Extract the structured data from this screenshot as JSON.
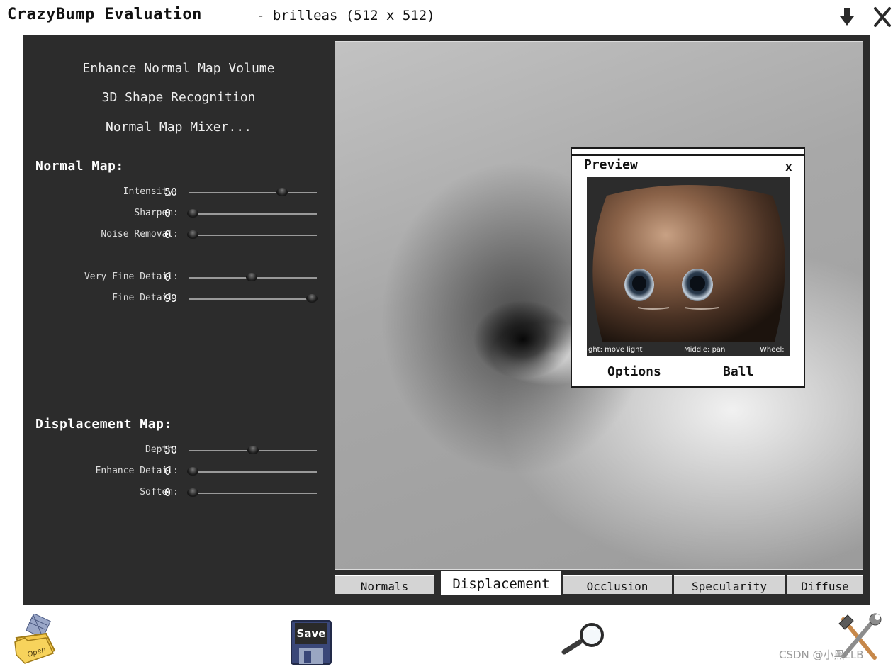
{
  "window": {
    "title": "CrazyBump Evaluation",
    "file_info": "- brilleas (512 x 512)"
  },
  "left_panel": {
    "actions": [
      "Enhance Normal Map Volume",
      "3D Shape Recognition",
      "Normal Map Mixer..."
    ],
    "normal_map": {
      "title": "Normal Map:",
      "sliders": [
        {
          "label": "Intensity:",
          "value": "50",
          "level": 0.73
        },
        {
          "label": "Sharpen:",
          "value": "0",
          "level": 0.03
        },
        {
          "label": "Noise Removal:",
          "value": "0",
          "level": 0.03
        },
        {
          "label": "Very Fine Detail:",
          "value": "0",
          "level": 0.49
        },
        {
          "label": "Fine Detail:",
          "value": "99",
          "level": 0.96
        }
      ]
    },
    "displacement_map": {
      "title": "Displacement Map:",
      "sliders": [
        {
          "label": "Depth:",
          "value": "50",
          "level": 0.5
        },
        {
          "label": "Enhance Detail:",
          "value": "0",
          "level": 0.03
        },
        {
          "label": "Soften:",
          "value": "0",
          "level": 0.03
        }
      ]
    }
  },
  "tabs": [
    {
      "label": "Normals",
      "active": false
    },
    {
      "label": "Displacement",
      "active": true
    },
    {
      "label": "Occlusion",
      "active": false
    },
    {
      "label": "Specularity",
      "active": false
    },
    {
      "label": "Diffuse",
      "active": false
    }
  ],
  "preview": {
    "title": "Preview",
    "close": "x",
    "help_right": "ght: move light",
    "help_middle": "Middle: pan",
    "help_wheel": "Wheel:",
    "options_label": "Options",
    "ball_label": "Ball"
  },
  "toolbar": {
    "open_label": "Open",
    "save_label": "Save"
  },
  "icons": {
    "minimize": "down-arrow-icon",
    "close": "close-x-icon",
    "open": "open-folder-icon",
    "save": "floppy-disk-icon",
    "zoom": "magnifier-icon",
    "settings": "hammer-wrench-icon"
  },
  "watermark": "CSDN @小黑LLB",
  "colors": {
    "panel_bg": "#2c2c2c",
    "tab_bg": "#d4d4d4",
    "active_tab_bg": "#ffffff"
  }
}
